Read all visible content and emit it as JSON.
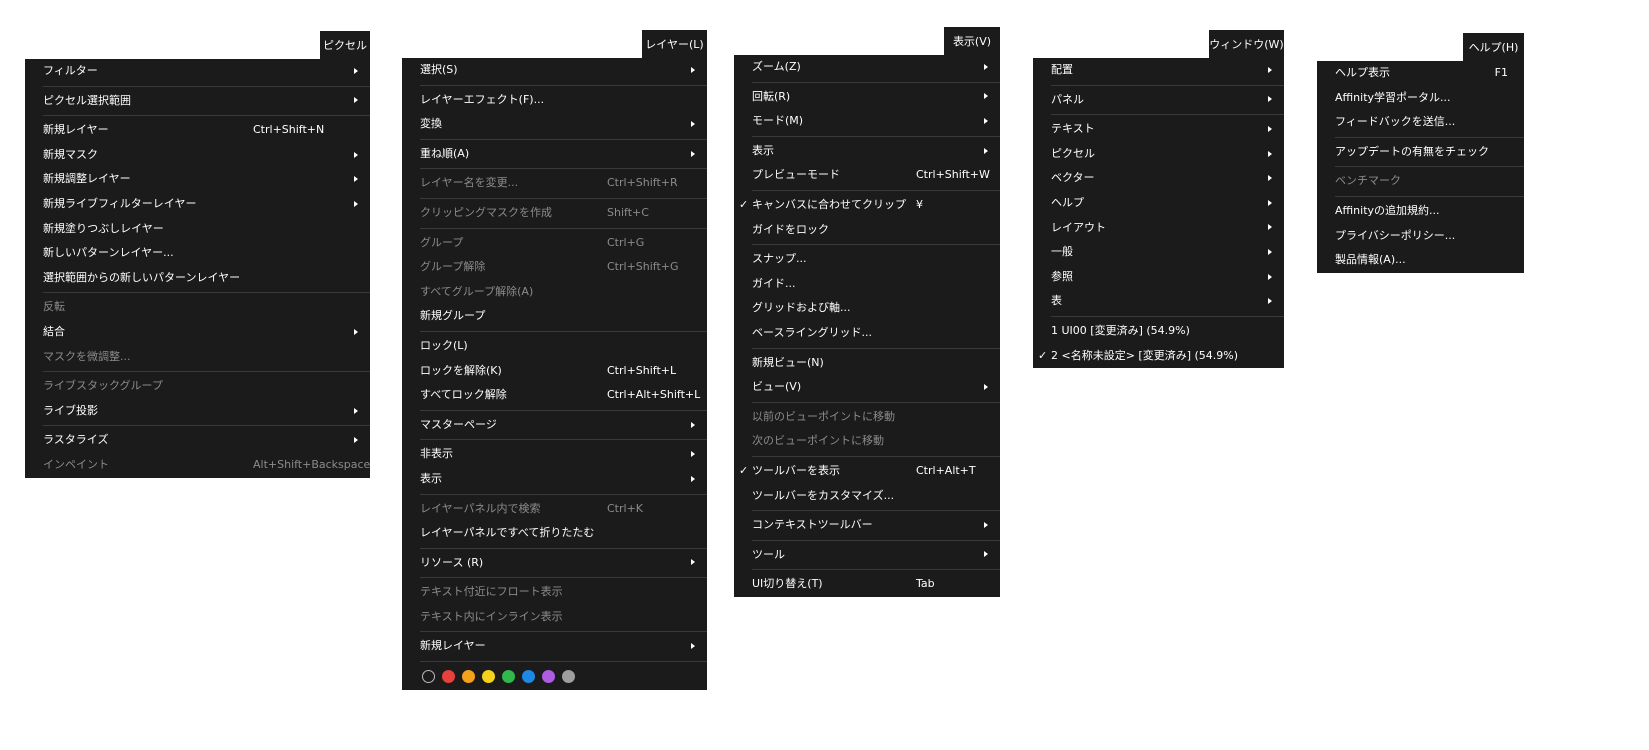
{
  "menus": {
    "pixel": {
      "title": "ピクセル",
      "items": [
        {
          "label": "フィルター",
          "arrow": true
        },
        {
          "sep": true
        },
        {
          "label": "ピクセル選択範囲",
          "arrow": true
        },
        {
          "sep": true
        },
        {
          "label": "新規レイヤー",
          "shortcut": "Ctrl+Shift+N"
        },
        {
          "label": "新規マスク",
          "arrow": true
        },
        {
          "label": "新規調整レイヤー",
          "arrow": true
        },
        {
          "label": "新規ライブフィルターレイヤー",
          "arrow": true
        },
        {
          "label": "新規塗りつぶしレイヤー"
        },
        {
          "label": "新しいパターンレイヤー..."
        },
        {
          "label": "選択範囲からの新しいパターンレイヤー"
        },
        {
          "sep": true
        },
        {
          "label": "反転",
          "disabled": true
        },
        {
          "label": "結合",
          "arrow": true
        },
        {
          "label": "マスクを微調整...",
          "disabled": true
        },
        {
          "sep": true
        },
        {
          "label": "ライブスタックグループ",
          "disabled": true
        },
        {
          "label": "ライブ投影",
          "arrow": true
        },
        {
          "sep": true
        },
        {
          "label": "ラスタライズ",
          "arrow": true
        },
        {
          "label": "インペイント",
          "disabled": true,
          "shortcut": "Alt+Shift+Backspace"
        }
      ]
    },
    "layer": {
      "title": "レイヤー(L)",
      "items": [
        {
          "label": "選択(S)",
          "arrow": true
        },
        {
          "sep": true
        },
        {
          "label": "レイヤーエフェクト(F)..."
        },
        {
          "label": "変換",
          "arrow": true
        },
        {
          "sep": true
        },
        {
          "label": "重ね順(A)",
          "arrow": true
        },
        {
          "sep": true
        },
        {
          "label": "レイヤー名を変更...",
          "disabled": true,
          "shortcut": "Ctrl+Shift+R"
        },
        {
          "sep": true
        },
        {
          "label": "クリッピングマスクを作成",
          "disabled": true,
          "shortcut": "Shift+C"
        },
        {
          "sep": true
        },
        {
          "label": "グループ",
          "disabled": true,
          "shortcut": "Ctrl+G"
        },
        {
          "label": "グループ解除",
          "disabled": true,
          "shortcut": "Ctrl+Shift+G"
        },
        {
          "label": "すべてグループ解除(A)",
          "disabled": true
        },
        {
          "label": "新規グループ"
        },
        {
          "sep": true
        },
        {
          "label": "ロック(L)"
        },
        {
          "label": "ロックを解除(K)",
          "shortcut": "Ctrl+Shift+L"
        },
        {
          "label": "すべてロック解除",
          "shortcut": "Ctrl+Alt+Shift+L"
        },
        {
          "sep": true
        },
        {
          "label": "マスターページ",
          "arrow": true
        },
        {
          "sep": true
        },
        {
          "label": "非表示",
          "arrow": true
        },
        {
          "label": "表示",
          "arrow": true
        },
        {
          "sep": true
        },
        {
          "label": "レイヤーパネル内で検索",
          "disabled": true,
          "shortcut": "Ctrl+K"
        },
        {
          "label": "レイヤーパネルですべて折りたたむ"
        },
        {
          "sep": true
        },
        {
          "label": "リソース (R)",
          "arrow": true
        },
        {
          "sep": true
        },
        {
          "label": "テキスト付近にフロート表示",
          "disabled": true
        },
        {
          "label": "テキスト内にインライン表示",
          "disabled": true
        },
        {
          "sep": true
        },
        {
          "label": "新規レイヤー",
          "arrow": true
        },
        {
          "sep": true
        },
        {
          "colors": [
            "none",
            "#e8403a",
            "#f2a31b",
            "#f4d21c",
            "#2fb84b",
            "#1e88e5",
            "#b05ce0",
            "#9e9e9e"
          ]
        }
      ]
    },
    "view": {
      "title": "表示(V)",
      "items": [
        {
          "label": "ズーム(Z)",
          "arrow": true
        },
        {
          "sep": true
        },
        {
          "label": "回転(R)",
          "arrow": true
        },
        {
          "label": "モード(M)",
          "arrow": true
        },
        {
          "sep": true
        },
        {
          "label": "表示",
          "arrow": true
        },
        {
          "label": "プレビューモード",
          "shortcut": "Ctrl+Shift+W"
        },
        {
          "sep": true
        },
        {
          "label": "キャンバスに合わせてクリップ",
          "check": "✓",
          "shortcut": "¥"
        },
        {
          "label": "ガイドをロック"
        },
        {
          "sep": true
        },
        {
          "label": "スナップ..."
        },
        {
          "label": "ガイド..."
        },
        {
          "label": "グリッドおよび軸..."
        },
        {
          "label": "ベースライングリッド..."
        },
        {
          "sep": true
        },
        {
          "label": "新規ビュー(N)"
        },
        {
          "label": "ビュー(V)",
          "arrow": true
        },
        {
          "sep": true
        },
        {
          "label": "以前のビューポイントに移動",
          "disabled": true
        },
        {
          "label": "次のビューポイントに移動",
          "disabled": true
        },
        {
          "sep": true
        },
        {
          "label": "ツールバーを表示",
          "check": "✓",
          "shortcut": "Ctrl+Alt+T"
        },
        {
          "label": "ツールバーをカスタマイズ..."
        },
        {
          "sep": true
        },
        {
          "label": "コンテキストツールバー",
          "arrow": true
        },
        {
          "sep": true
        },
        {
          "label": "ツール",
          "arrow": true
        },
        {
          "sep": true
        },
        {
          "label": "UI切り替え(T)",
          "shortcut": "Tab"
        }
      ]
    },
    "window": {
      "title": "ウィンドウ(W)",
      "items": [
        {
          "label": "配置",
          "arrow": true
        },
        {
          "sep": true
        },
        {
          "label": "パネル",
          "arrow": true
        },
        {
          "sep": true
        },
        {
          "label": "テキスト",
          "arrow": true
        },
        {
          "label": "ピクセル",
          "arrow": true
        },
        {
          "label": "ベクター",
          "arrow": true
        },
        {
          "label": "ヘルプ",
          "arrow": true
        },
        {
          "label": "レイアウト",
          "arrow": true
        },
        {
          "label": "一般",
          "arrow": true
        },
        {
          "label": "参照",
          "arrow": true
        },
        {
          "label": "表",
          "arrow": true
        },
        {
          "sep": true
        },
        {
          "label": "1 UI00 [変更済み] (54.9%)"
        },
        {
          "label": "2 <名称未設定> [変更済み] (54.9%)",
          "check": "✓"
        }
      ]
    },
    "help": {
      "title": "ヘルプ(H)",
      "items": [
        {
          "label": "ヘルプ表示",
          "shortcut": "F1"
        },
        {
          "label": "Affinity学習ポータル..."
        },
        {
          "label": "フィードバックを送信..."
        },
        {
          "sep": true
        },
        {
          "label": "アップデートの有無をチェック"
        },
        {
          "sep": true
        },
        {
          "label": "ベンチマーク",
          "disabled": true
        },
        {
          "sep": true
        },
        {
          "label": "Affinityの追加規約..."
        },
        {
          "label": "プライバシーポリシー..."
        },
        {
          "label": "製品情報(A)..."
        }
      ]
    }
  }
}
